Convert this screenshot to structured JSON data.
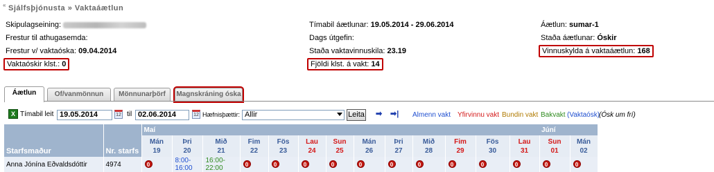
{
  "breadcrumb": {
    "back": "«",
    "text": "Sjálfsþjónusta » Vaktaáætlun"
  },
  "info": {
    "col1": [
      {
        "label": "Skipulagseining:",
        "value": "",
        "blurred": true
      },
      {
        "label": "Frestur til athugasemda:",
        "value": ""
      },
      {
        "label": "Frestur v/ vaktaóska:",
        "value": "09.04.2014"
      },
      {
        "label": "Vaktaóskir klst.:",
        "value": "0",
        "highlight": true
      }
    ],
    "col2": [
      {
        "label": "Tímabil áætlunar:",
        "value": "19.05.2014 - 29.06.2014"
      },
      {
        "label": "Dags útgefin:",
        "value": ""
      },
      {
        "label": "Staða vaktavinnuskila:",
        "value": "23.19"
      },
      {
        "label": "Fjöldi klst. á vakt:",
        "value": "14",
        "highlight": true
      }
    ],
    "col3": [
      {
        "label": "Áætlun:",
        "value": "sumar-1"
      },
      {
        "label": "Staða áætlunar:",
        "value": "Óskir"
      },
      {
        "label": "Vinnuskylda á vaktaáætlun:",
        "value": "168",
        "highlight": true
      }
    ]
  },
  "tabs": [
    "Áætlun",
    "Of/vanmönnun",
    "Mönnunarþörf",
    "Magnskráning óska"
  ],
  "toolbar": {
    "period_label": "Tímabil leit",
    "from_date": "19.05.2014",
    "to_label": "til",
    "to_date": "02.06.2014",
    "skills_label": "Hæfnisþættir:",
    "skills_value": "Allir",
    "search_button": "Leita",
    "arrow_right": "➡",
    "arrow_end": "➡|"
  },
  "legend": [
    {
      "text": "Almenn vakt",
      "color": "#1f4fd0"
    },
    {
      "text": "Yfirvinnu vakt",
      "color": "#d41a1a"
    },
    {
      "text": "Bundin vakt",
      "color": "#b07a00"
    },
    {
      "text": "Bakvakt",
      "color": "#2e8a1e"
    },
    {
      "text": "(Vaktaósk)",
      "color": "#1f4fd0"
    },
    {
      "text": "(Ósk um frí)",
      "color": "#000000",
      "italic": true
    }
  ],
  "schedule": {
    "months": [
      {
        "name": "Maí",
        "span": 14
      },
      {
        "name": "Júní",
        "span": 2
      }
    ],
    "col_staff": "Starfsmaður",
    "col_nr": "Nr. starfs",
    "days": [
      {
        "dow": "Mán",
        "date": "19",
        "weekend": false
      },
      {
        "dow": "Þri",
        "date": "20",
        "weekend": false
      },
      {
        "dow": "Mið",
        "date": "21",
        "weekend": false
      },
      {
        "dow": "Fim",
        "date": "22",
        "weekend": false
      },
      {
        "dow": "Fös",
        "date": "23",
        "weekend": false
      },
      {
        "dow": "Lau",
        "date": "24",
        "weekend": true
      },
      {
        "dow": "Sun",
        "date": "25",
        "weekend": true
      },
      {
        "dow": "Mán",
        "date": "26",
        "weekend": false
      },
      {
        "dow": "Þri",
        "date": "27",
        "weekend": false
      },
      {
        "dow": "Mið",
        "date": "28",
        "weekend": false
      },
      {
        "dow": "Fim",
        "date": "29",
        "weekend": true
      },
      {
        "dow": "Fös",
        "date": "30",
        "weekend": false
      },
      {
        "dow": "Lau",
        "date": "31",
        "weekend": true
      },
      {
        "dow": "Sun",
        "date": "01",
        "weekend": true
      },
      {
        "dow": "Mán",
        "date": "02",
        "weekend": false
      }
    ],
    "rows": [
      {
        "name": "Anna Jónína Eðvaldsdóttir",
        "nr": "4974",
        "cells": [
          {
            "type": "dot",
            "text": "0"
          },
          {
            "type": "shift",
            "text": "8:00-16:00",
            "kind": "blue"
          },
          {
            "type": "shift",
            "text": "16:00-22:00",
            "kind": "green"
          },
          {
            "type": "dot",
            "text": "0"
          },
          {
            "type": "dot",
            "text": "0"
          },
          {
            "type": "dot",
            "text": "0"
          },
          {
            "type": "dot",
            "text": "0"
          },
          {
            "type": "dot",
            "text": "0"
          },
          {
            "type": "dot",
            "text": "0"
          },
          {
            "type": "dot",
            "text": "0"
          },
          {
            "type": "dot",
            "text": "0"
          },
          {
            "type": "dot",
            "text": "0"
          },
          {
            "type": "dot",
            "text": "0"
          },
          {
            "type": "dot",
            "text": "0"
          },
          {
            "type": "dot",
            "text": "0"
          }
        ]
      }
    ]
  }
}
